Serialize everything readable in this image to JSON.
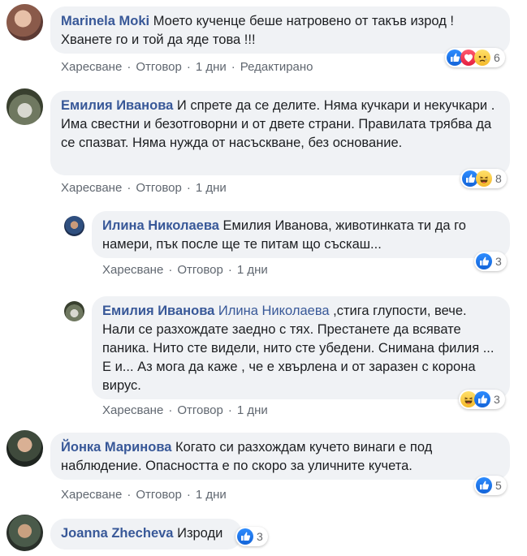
{
  "comments": [
    {
      "author": "Marinela Moki",
      "text": "Моето кученце беше натровено от такъв изрод ! Хванете го и той да яде това !!!",
      "actions": {
        "like": "Харесване",
        "reply": "Отговор",
        "time": "1 дни",
        "edited": "Редактирано"
      },
      "reactions": {
        "count": "6",
        "icons": [
          "like-icon",
          "love-icon",
          "sad-icon"
        ]
      }
    },
    {
      "author": "Емилия Иванова",
      "text": "И спрете да се делите. Няма кучкари и некучкари . Има свестни и безотговорни и от двете страни. Правилата трябва да се спазват. Няма нужда от насъскване, без основание.",
      "actions": {
        "like": "Харесване",
        "reply": "Отговор",
        "time": "1 дни"
      },
      "reactions": {
        "count": "8",
        "icons": [
          "like-icon",
          "haha-icon"
        ]
      }
    },
    {
      "author": "Илина Николаева",
      "text": "Емилия Иванова, животинката ти да го намери, пък после ще те питам що съскаш...",
      "actions": {
        "like": "Харесване",
        "reply": "Отговор",
        "time": "1 дни"
      },
      "reactions": {
        "count": "3",
        "icons": [
          "like-icon"
        ]
      }
    },
    {
      "author": "Емилия Иванова",
      "mention": "Илина Николаева",
      "text": " ,стига глупости, вече. Нали се разхождате заедно с тях. Престанете да всявате паника. Нито сте видели, нито сте убедени. Снимана филия ... Е и... Аз мога да каже , че е хвърлена и от заразен с корона вирус.",
      "actions": {
        "like": "Харесване",
        "reply": "Отговор",
        "time": "1 дни"
      },
      "reactions": {
        "count": "3",
        "icons": [
          "haha-icon",
          "like-icon"
        ]
      }
    },
    {
      "author": "Йонка Маринова",
      "text": "Когато си разхождам кучето винаги е под наблюдение. Опасността е по скоро за уличните кучета.",
      "actions": {
        "like": "Харесване",
        "reply": "Отговор",
        "time": "1 дни"
      },
      "reactions": {
        "count": "5",
        "icons": [
          "like-icon"
        ]
      }
    },
    {
      "author": "Joanna Zhecheva",
      "text": "Изроди",
      "reactions": {
        "count": "3",
        "icons": [
          "like-icon"
        ]
      }
    }
  ],
  "colors": {
    "author": "#385898",
    "bubble": "#f0f2f5",
    "meta": "#606770",
    "like": "#1877f2"
  }
}
